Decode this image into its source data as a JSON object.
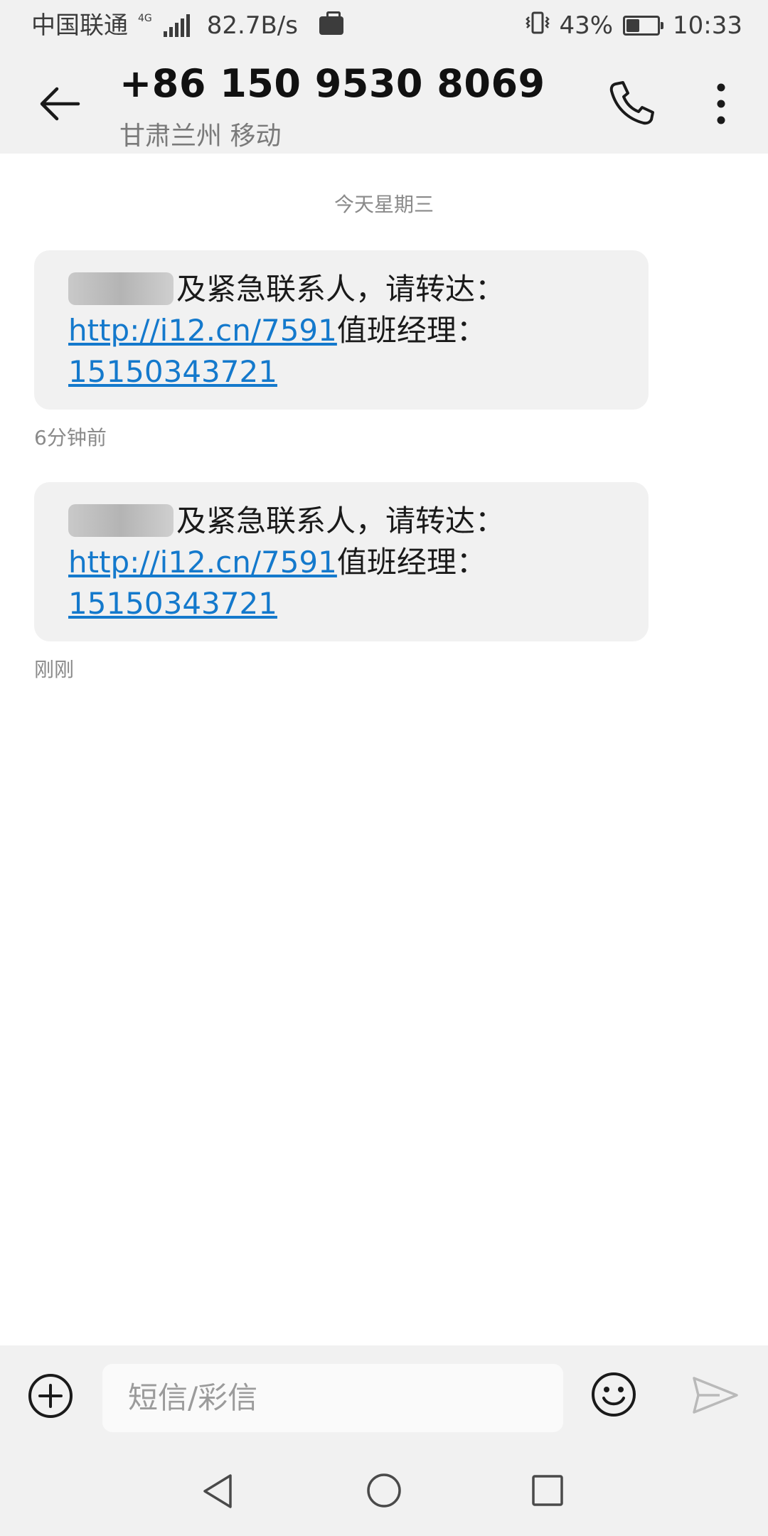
{
  "status_bar": {
    "carrier": "中国联通",
    "network": "4G",
    "speed": "82.7B/s",
    "battery": "43%",
    "battery_level": 0.43,
    "time": "10:33"
  },
  "header": {
    "title": "+86 150 9530 8069",
    "subtitle": "甘肃兰州 移动"
  },
  "conversation": {
    "date_divider": "今天星期三",
    "messages": [
      {
        "visible_start": "及紧急联系人，请转达：",
        "link": "http://i12.cn/7591",
        "after_link": "值班经理：",
        "phone": "15150343721",
        "time": "6分钟前"
      },
      {
        "visible_start": "及紧急联系人，请转达：",
        "link": "http://i12.cn/7591",
        "after_link": "值班经理：",
        "phone": "15150343721",
        "time": "刚刚"
      }
    ]
  },
  "compose": {
    "placeholder": "短信/彩信"
  },
  "icons": {
    "back": "arrow-left-icon",
    "call": "phone-icon",
    "more": "more-vertical-icon",
    "add": "plus-circle-icon",
    "emoji": "smiley-icon",
    "send": "send-icon",
    "nav_back": "triangle-back-icon",
    "nav_home": "circle-home-icon",
    "nav_recent": "square-recent-icon"
  },
  "colors": {
    "bar_bg": "#f1f1f1",
    "bubble_bg": "#f1f1f1",
    "link": "#1479cc",
    "secondary_text": "#8a8a8a"
  }
}
